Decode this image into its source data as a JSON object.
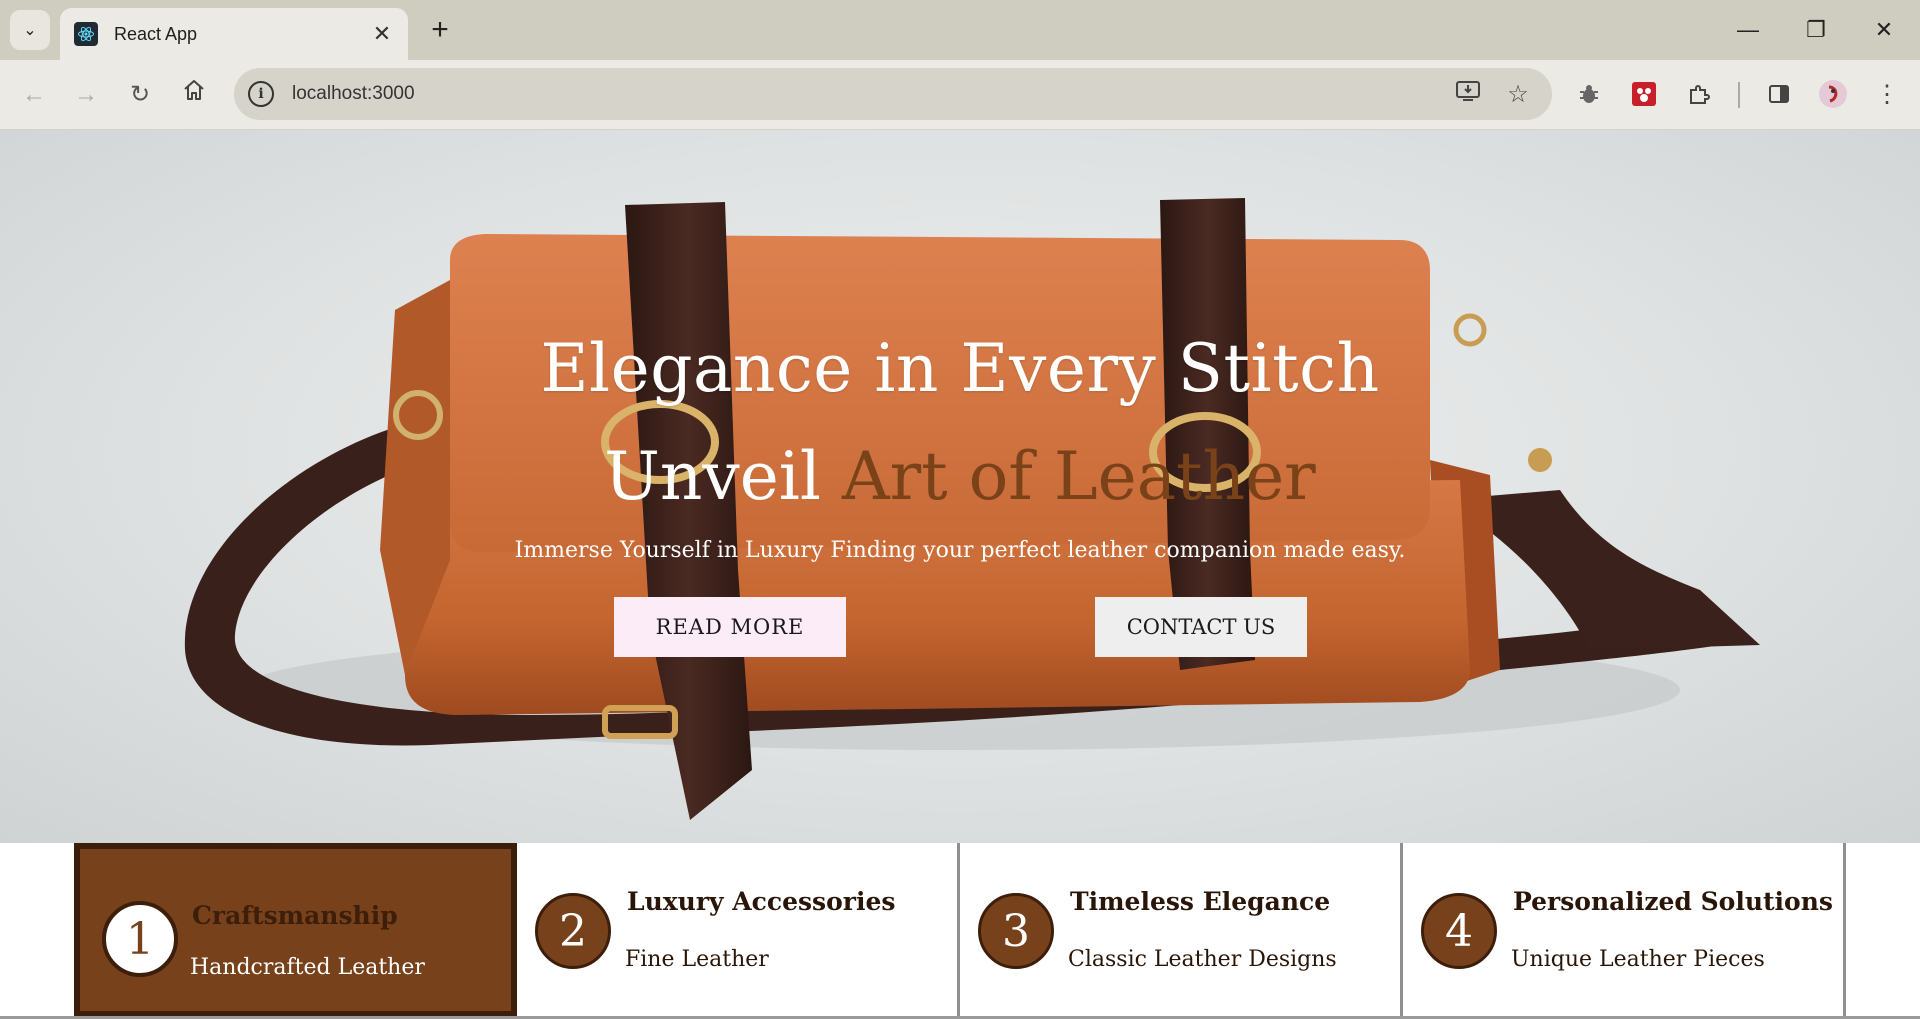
{
  "browser": {
    "tab_title": "React App",
    "url": "localhost:3000",
    "icons": [
      "tab-search-icon",
      "react-favicon-icon",
      "close-icon",
      "plus-icon",
      "minimize-icon",
      "restore-icon",
      "window-close-icon",
      "back-icon",
      "forward-icon",
      "reload-icon",
      "home-icon",
      "info-icon",
      "install-icon",
      "star-icon",
      "bug-extension-icon",
      "red-extension-icon",
      "puzzle-icon",
      "sidepanel-icon",
      "profile-avatar-icon",
      "more-menu-icon"
    ]
  },
  "hero": {
    "title": "Elegance in Every Stitch",
    "subtitle_plain": "Unveil",
    "subtitle_accent": "Art of Leather",
    "description": "Immerse Yourself in Luxury Finding your perfect leather companion made easy.",
    "read_more_label": "READ MORE",
    "contact_label": "CONTACT US",
    "accent_color": "#7a4219"
  },
  "features": [
    {
      "number": "1",
      "title": "Craftsmanship",
      "text": "Handcrafted Leather",
      "active": true
    },
    {
      "number": "2",
      "title": "Luxury Accessories",
      "text": "Fine Leather",
      "active": false
    },
    {
      "number": "3",
      "title": "Timeless Elegance",
      "text": "Classic Leather Designs",
      "active": false
    },
    {
      "number": "4",
      "title": "Personalized Solutions",
      "text": "Unique Leather Pieces",
      "active": false
    }
  ],
  "colors": {
    "brand_brown": "#77411b",
    "dark_brown": "#3c1e0b",
    "read_more_bg": "#fcecf8"
  }
}
